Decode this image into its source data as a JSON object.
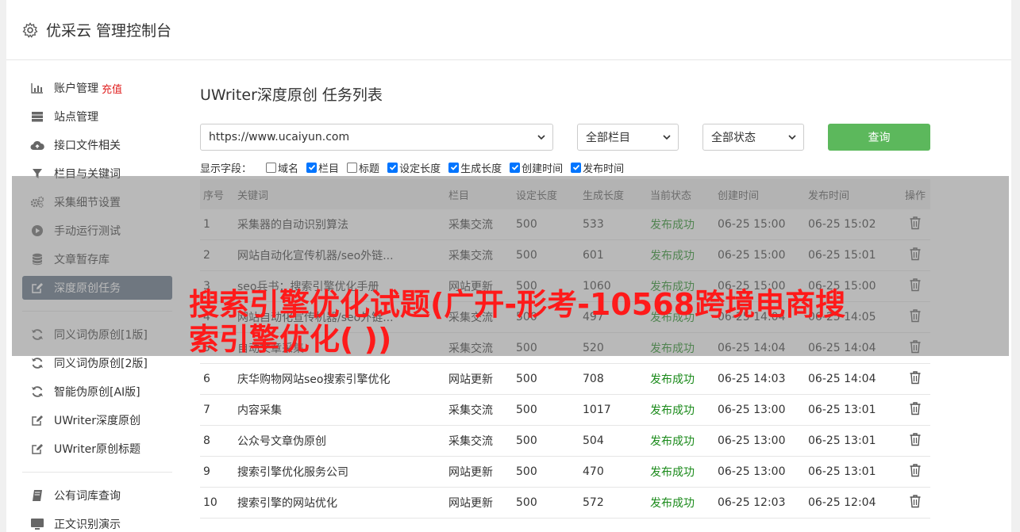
{
  "header": {
    "title": "优采云 管理控制台"
  },
  "sidebar": {
    "recharge": "充值",
    "groups": [
      [
        {
          "label": "账户管理",
          "icon": "bar-chart-icon"
        },
        {
          "label": "站点管理",
          "icon": "server-icon"
        },
        {
          "label": "接口文件相关",
          "icon": "cloud-upload-icon"
        },
        {
          "label": "栏目与关键词",
          "icon": "filter-icon"
        },
        {
          "label": "采集细节设置",
          "icon": "gears-icon"
        },
        {
          "label": "手动运行测试",
          "icon": "play-circle-icon"
        },
        {
          "label": "文章暂存库",
          "icon": "database-icon"
        },
        {
          "label": "深度原创任务",
          "icon": "edit-icon"
        }
      ],
      [
        {
          "label": "同义词伪原创[1版]",
          "icon": "refresh-icon"
        },
        {
          "label": "同义词伪原创[2版]",
          "icon": "refresh-icon"
        },
        {
          "label": "智能伪原创[AI版]",
          "icon": "refresh-icon"
        },
        {
          "label": "UWriter深度原创",
          "icon": "edit-icon"
        },
        {
          "label": "UWriter原创标题",
          "icon": "edit-icon"
        }
      ],
      [
        {
          "label": "公有词库查询",
          "icon": "book-icon"
        },
        {
          "label": "正文识别演示",
          "icon": "monitor-icon"
        }
      ]
    ]
  },
  "main": {
    "title": "UWriter深度原创 任务列表",
    "site_select": "https://www.ucaiyun.com",
    "column_select": "全部栏目",
    "status_select": "全部状态",
    "query_label": "查询",
    "fields_label": "显示字段：",
    "fields": [
      {
        "label": "域名",
        "checked": false
      },
      {
        "label": "栏目",
        "checked": true
      },
      {
        "label": "标题",
        "checked": false
      },
      {
        "label": "设定长度",
        "checked": true
      },
      {
        "label": "生成长度",
        "checked": true
      },
      {
        "label": "创建时间",
        "checked": true
      },
      {
        "label": "发布时间",
        "checked": true
      }
    ],
    "columns": [
      "序号",
      "关键词",
      "栏目",
      "设定长度",
      "生成长度",
      "当前状态",
      "创建时间",
      "发布时间",
      "操作"
    ],
    "rows": [
      [
        "1",
        "采集器的自动识别算法",
        "采集交流",
        "500",
        "533",
        "发布成功",
        "06-25 15:00",
        "06-25 15:02"
      ],
      [
        "2",
        "网站自动化宣传机器/seo外链...",
        "采集交流",
        "500",
        "601",
        "发布成功",
        "06-25 15:00",
        "06-25 15:01"
      ],
      [
        "3",
        "seo兵书：搜索引擎优化手册",
        "网站更新",
        "500",
        "1060",
        "发布成功",
        "06-25 15:00",
        "06-25 15:00"
      ],
      [
        "4",
        "网站自动化宣传机器/seo外链...",
        "采集交流",
        "500",
        "497",
        "发布成功",
        "06-25 14:04",
        "06-25 14:05"
      ],
      [
        "5",
        "自动文章采集",
        "采集交流",
        "500",
        "520",
        "发布成功",
        "06-25 14:04",
        "06-25 14:04"
      ],
      [
        "6",
        "庆华购物网站seo搜索引擎优化",
        "网站更新",
        "500",
        "708",
        "发布成功",
        "06-25 14:03",
        "06-25 14:04"
      ],
      [
        "7",
        "内容采集",
        "采集交流",
        "500",
        "1017",
        "发布成功",
        "06-25 13:00",
        "06-25 13:01"
      ],
      [
        "8",
        "公众号文章伪原创",
        "采集交流",
        "500",
        "504",
        "发布成功",
        "06-25 13:00",
        "06-25 13:01"
      ],
      [
        "9",
        "搜索引擎优化服务公司",
        "网站更新",
        "500",
        "470",
        "发布成功",
        "06-25 13:00",
        "06-25 13:01"
      ],
      [
        "10",
        "搜索引擎的网站优化",
        "网站更新",
        "500",
        "572",
        "发布成功",
        "06-25 12:03",
        "06-25 12:04"
      ]
    ]
  },
  "overlay_text": "搜索引擎优化试题(广开-形考-10568跨境电商搜索引擎优化( ))",
  "colors": {
    "primary": "#5cb85c",
    "active_nav": "#5b6d82",
    "success": "#1a8a1a",
    "accent_red": "#ff1a1a"
  }
}
